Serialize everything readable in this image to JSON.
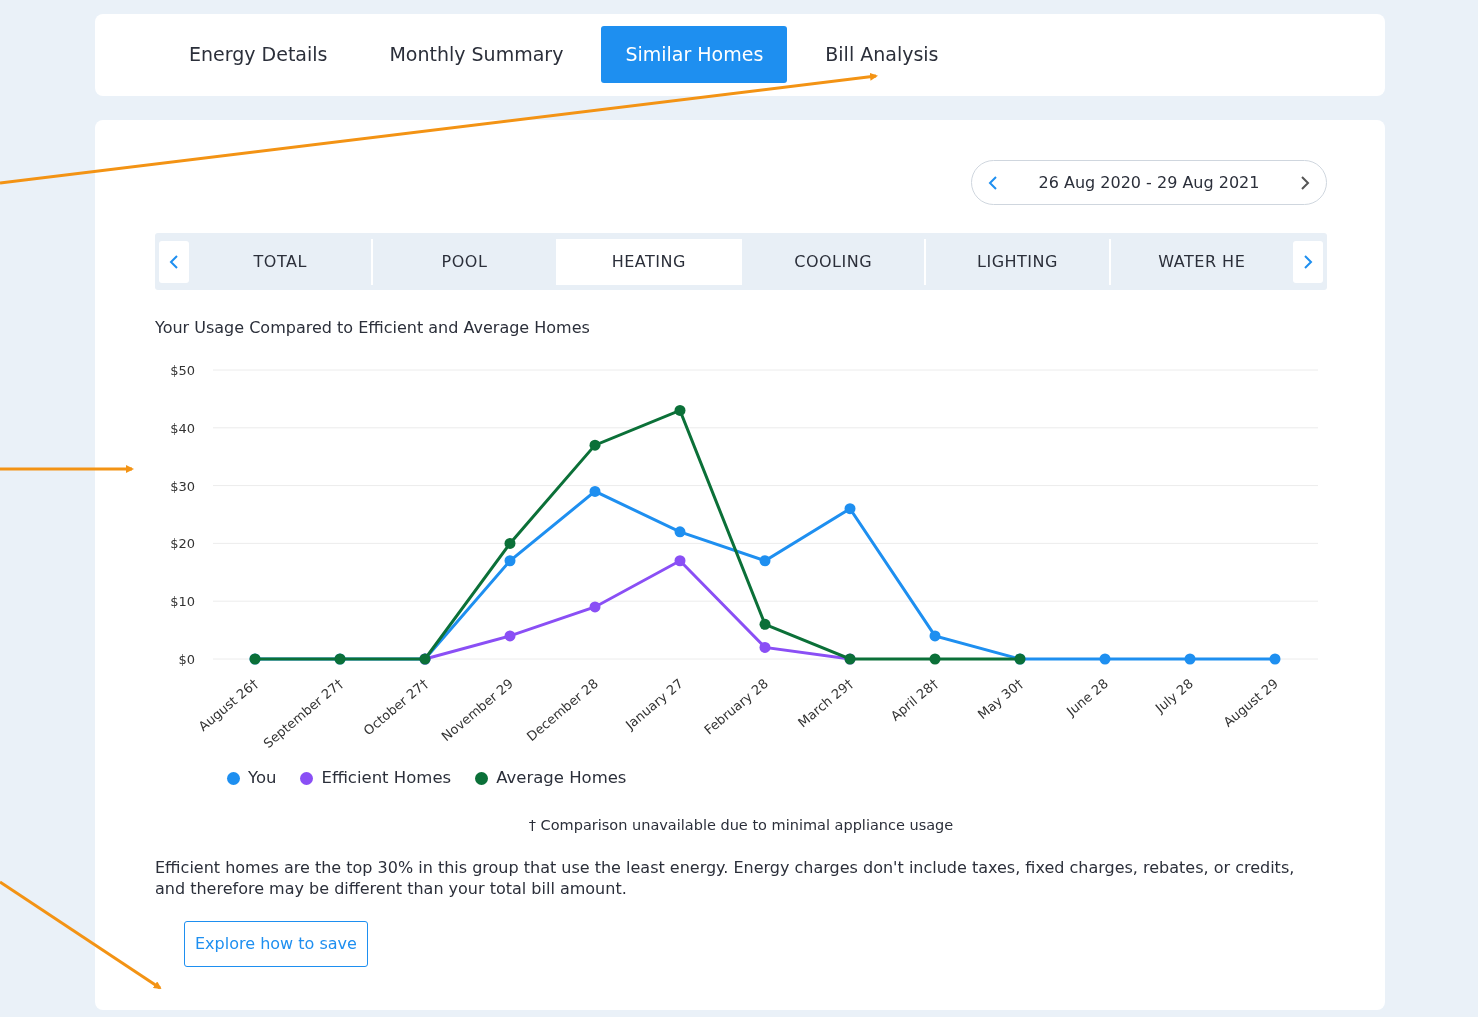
{
  "page_tabs": [
    {
      "label": "Energy Details",
      "selected": false
    },
    {
      "label": "Monthly Summary",
      "selected": false
    },
    {
      "label": "Similar Homes",
      "selected": true
    },
    {
      "label": "Bill Analysis",
      "selected": false
    }
  ],
  "date_range": {
    "label": "26 Aug 2020 - 29 Aug 2021"
  },
  "categories": [
    {
      "label": "TOTAL",
      "selected": false
    },
    {
      "label": "POOL",
      "selected": false
    },
    {
      "label": "HEATING",
      "selected": true
    },
    {
      "label": "COOLING",
      "selected": false
    },
    {
      "label": "LIGHTING",
      "selected": false
    },
    {
      "label": "WATER HE",
      "selected": false
    }
  ],
  "chart": {
    "title": "Your Usage Compared to Efficient and Average Homes",
    "chart_data": {
      "type": "line",
      "categories": [
        "August 26†",
        "September 27†",
        "October 27†",
        "November 29",
        "December 28",
        "January 27",
        "February 28",
        "March 29†",
        "April 28†",
        "May 30†",
        "June 28",
        "July 28",
        "August 29"
      ],
      "ylim": [
        0,
        50
      ],
      "grid": true,
      "yticks": [
        {
          "value": 0,
          "label": "$0"
        },
        {
          "value": 10,
          "label": "$10"
        },
        {
          "value": 20,
          "label": "$20"
        },
        {
          "value": 30,
          "label": "$30"
        },
        {
          "value": 40,
          "label": "$40"
        },
        {
          "value": 50,
          "label": "$50"
        }
      ],
      "series": [
        {
          "name": "You",
          "color": "#1e8ff0",
          "marker": true,
          "values": [
            0,
            0,
            0,
            17,
            29,
            22,
            17,
            26,
            4,
            0,
            0,
            0,
            0
          ]
        },
        {
          "name": "Efficient Homes",
          "color": "#8a4ff5",
          "marker": true,
          "values": [
            null,
            null,
            0,
            4,
            9,
            17,
            2,
            0,
            null,
            null,
            null,
            null,
            null
          ]
        },
        {
          "name": "Average Homes",
          "color": "#0b7038",
          "marker": true,
          "values": [
            0,
            0,
            0,
            20,
            37,
            43,
            6,
            0,
            0,
            0,
            null,
            null,
            null
          ]
        }
      ]
    }
  },
  "footnote": "† Comparison unavailable due to minimal appliance usage",
  "description": "Efficient homes are the top 30% in this group that use the least energy. Energy charges don't include taxes, fixed charges, rebates, or credits, and therefore may be different than your total bill amount.",
  "action_button": "Explore how to save"
}
